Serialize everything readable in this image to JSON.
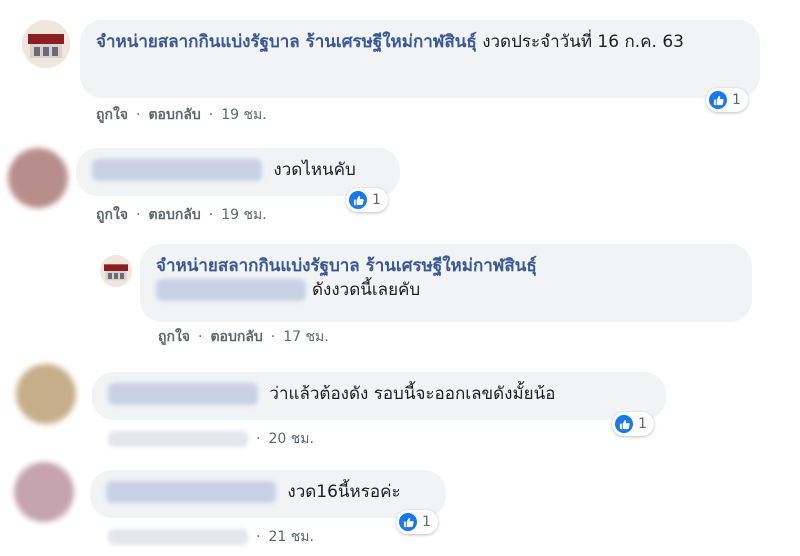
{
  "comments": [
    {
      "author": "จำหน่ายสลากกินแบ่งรัฐบาล ร้านเศรษฐีใหม่กาฬสินธุ์",
      "text": " งวดประจำวันที่ 16 ก.ค. 63",
      "like_label": "ถูกใจ",
      "reply_label": "ตอบกลับ",
      "time": "19 ชม.",
      "reaction_count": "1"
    },
    {
      "text": "งวดไหนคับ",
      "like_label": "ถูกใจ",
      "reply_label": "ตอบกลับ",
      "time": "19 ชม.",
      "reaction_count": "1"
    },
    {
      "author": "จำหน่ายสลากกินแบ่งรัฐบาล ร้านเศรษฐีใหม่กาฬสินธุ์",
      "text": "ดังงวดนี้เลยคับ",
      "like_label": "ถูกใจ",
      "reply_label": "ตอบกลับ",
      "time": "17 ชม."
    },
    {
      "text": "ว่าแล้วต้องดัง รอบนี้จะออกเลขดังมั้ยน้อ",
      "time": "20 ชม.",
      "reaction_count": "1"
    },
    {
      "text": "งวด16นี้หรอค่ะ",
      "time": "21 ชม.",
      "reaction_count": "1"
    }
  ],
  "icons": {
    "reaction": "thumbs-up-icon",
    "separator": "·"
  },
  "colors": {
    "author": "#385898",
    "bubble": "#f2f3f5",
    "like": "#1877f2",
    "meta": "#606770"
  }
}
